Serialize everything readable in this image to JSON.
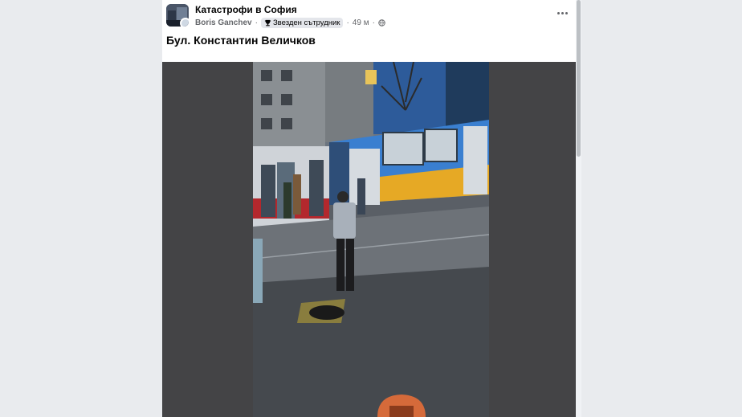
{
  "post": {
    "group_name": "Катастрофи в София",
    "author": "Boris Ganchev",
    "separator": "·",
    "badge_label": "Звезден сътрудник",
    "time": "49 м",
    "text": "Бул. Константин Величков"
  },
  "icons": {
    "avatar": "group-avatar",
    "badge": "trophy-icon",
    "privacy": "globe-icon",
    "menu": "more-options-icon"
  },
  "colors": {
    "page_bg": "#e9ebee",
    "card_bg": "#ffffff",
    "media_bg": "#444446",
    "primary_text": "#050505",
    "secondary_text": "#65676b",
    "tram_blue": "#3a7fd0",
    "tram_yellow": "#e6a925"
  }
}
